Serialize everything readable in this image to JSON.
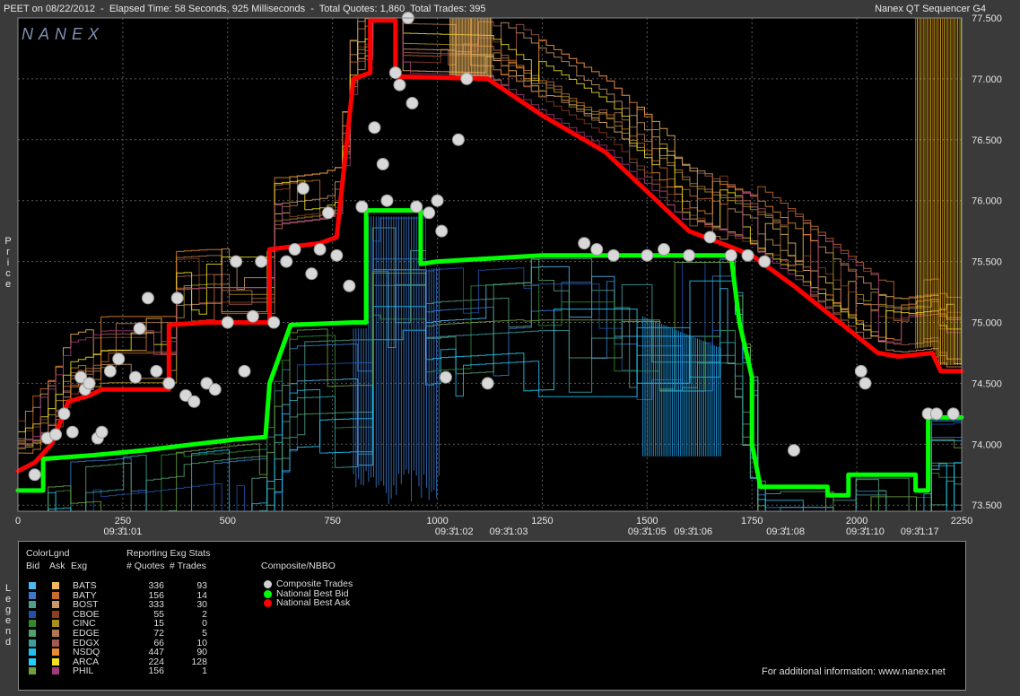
{
  "header": {
    "title": "PEET on 08/22/2012  -  Elapsed Time: 58 Seconds, 925 Milliseconds  -  Total Quotes: 1,860  Total Trades: 395",
    "app": "Nanex QT Sequencer G4"
  },
  "logo": "NANEX",
  "colors": {
    "background": "#3a3a3a",
    "plot": "#000000",
    "grid": "#5a5a5a",
    "bid": "#00ff00",
    "ask": "#ff0000",
    "trade": "#d8d8d8"
  },
  "chart_data": {
    "type": "scatter",
    "ylabel": "Price",
    "xlim": [
      0,
      2250
    ],
    "ylim": [
      73.45,
      77.5
    ],
    "x_ticks": [
      0,
      250,
      500,
      750,
      1000,
      1250,
      1500,
      1750,
      2000,
      2250
    ],
    "y_ticks": [
      "73.500",
      "74.000",
      "74.500",
      "75.000",
      "75.500",
      "76.000",
      "76.500",
      "77.000",
      "77.500"
    ],
    "time_ticks": [
      {
        "x": 250,
        "label": "09:31:01"
      },
      {
        "x": 1040,
        "label": "09:31:02"
      },
      {
        "x": 1170,
        "label": "09:31:03"
      },
      {
        "x": 1500,
        "label": "09:31:05"
      },
      {
        "x": 1610,
        "label": "09:31:06"
      },
      {
        "x": 1830,
        "label": "09:31:08"
      },
      {
        "x": 2020,
        "label": "09:31:10"
      },
      {
        "x": 2150,
        "label": "09:31:17"
      }
    ],
    "national_best_bid": [
      [
        0,
        73.62
      ],
      [
        60,
        73.62
      ],
      [
        60,
        73.88
      ],
      [
        180,
        73.91
      ],
      [
        300,
        73.95
      ],
      [
        420,
        74.0
      ],
      [
        520,
        74.04
      ],
      [
        590,
        74.06
      ],
      [
        600,
        74.5
      ],
      [
        650,
        74.98
      ],
      [
        800,
        75.0
      ],
      [
        830,
        75.0
      ],
      [
        830,
        75.92
      ],
      [
        960,
        75.92
      ],
      [
        960,
        75.48
      ],
      [
        1000,
        75.5
      ],
      [
        1150,
        75.53
      ],
      [
        1250,
        75.55
      ],
      [
        1500,
        75.55
      ],
      [
        1700,
        75.55
      ],
      [
        1720,
        75.0
      ],
      [
        1750,
        74.55
      ],
      [
        1750,
        74.0
      ],
      [
        1770,
        73.65
      ],
      [
        1930,
        73.65
      ],
      [
        1930,
        73.58
      ],
      [
        1980,
        73.58
      ],
      [
        1980,
        73.75
      ],
      [
        2140,
        73.75
      ],
      [
        2140,
        73.62
      ],
      [
        2170,
        73.62
      ],
      [
        2170,
        74.22
      ],
      [
        2250,
        74.22
      ]
    ],
    "national_best_ask": [
      [
        0,
        73.78
      ],
      [
        40,
        73.85
      ],
      [
        80,
        74.0
      ],
      [
        120,
        74.35
      ],
      [
        170,
        74.4
      ],
      [
        200,
        74.45
      ],
      [
        300,
        74.45
      ],
      [
        360,
        74.45
      ],
      [
        360,
        74.98
      ],
      [
        450,
        75.0
      ],
      [
        600,
        75.0
      ],
      [
        600,
        75.6
      ],
      [
        720,
        75.65
      ],
      [
        760,
        75.7
      ],
      [
        800,
        77.0
      ],
      [
        840,
        77.05
      ],
      [
        840,
        77.48
      ],
      [
        900,
        77.48
      ],
      [
        900,
        77.02
      ],
      [
        1120,
        77.0
      ],
      [
        1250,
        76.7
      ],
      [
        1400,
        76.4
      ],
      [
        1600,
        75.75
      ],
      [
        1700,
        75.62
      ],
      [
        1750,
        75.55
      ],
      [
        1850,
        75.3
      ],
      [
        2050,
        74.75
      ],
      [
        2100,
        74.72
      ],
      [
        2180,
        74.75
      ],
      [
        2200,
        74.6
      ],
      [
        2250,
        74.6
      ]
    ],
    "composite_trades": [
      [
        40,
        73.75
      ],
      [
        70,
        74.05
      ],
      [
        90,
        74.08
      ],
      [
        110,
        74.25
      ],
      [
        130,
        74.1
      ],
      [
        150,
        74.55
      ],
      [
        160,
        74.45
      ],
      [
        170,
        74.5
      ],
      [
        190,
        74.05
      ],
      [
        200,
        74.1
      ],
      [
        220,
        74.6
      ],
      [
        240,
        74.7
      ],
      [
        280,
        74.55
      ],
      [
        290,
        74.95
      ],
      [
        310,
        75.2
      ],
      [
        330,
        74.6
      ],
      [
        360,
        74.5
      ],
      [
        380,
        75.2
      ],
      [
        400,
        74.4
      ],
      [
        420,
        74.35
      ],
      [
        450,
        74.5
      ],
      [
        470,
        74.45
      ],
      [
        500,
        75.0
      ],
      [
        520,
        75.5
      ],
      [
        540,
        74.6
      ],
      [
        560,
        75.05
      ],
      [
        580,
        75.5
      ],
      [
        610,
        75.0
      ],
      [
        640,
        75.5
      ],
      [
        660,
        75.6
      ],
      [
        680,
        76.1
      ],
      [
        700,
        75.4
      ],
      [
        720,
        75.6
      ],
      [
        740,
        75.9
      ],
      [
        760,
        75.55
      ],
      [
        790,
        75.3
      ],
      [
        820,
        75.95
      ],
      [
        850,
        76.6
      ],
      [
        870,
        76.3
      ],
      [
        880,
        76.0
      ],
      [
        900,
        77.05
      ],
      [
        910,
        76.95
      ],
      [
        930,
        77.5
      ],
      [
        940,
        76.8
      ],
      [
        950,
        75.95
      ],
      [
        980,
        75.9
      ],
      [
        1000,
        76.0
      ],
      [
        1010,
        75.75
      ],
      [
        1020,
        74.55
      ],
      [
        1050,
        76.5
      ],
      [
        1070,
        77.0
      ],
      [
        1120,
        74.5
      ],
      [
        1350,
        75.65
      ],
      [
        1380,
        75.6
      ],
      [
        1420,
        75.55
      ],
      [
        1500,
        75.55
      ],
      [
        1540,
        75.6
      ],
      [
        1600,
        75.55
      ],
      [
        1650,
        75.7
      ],
      [
        1700,
        75.55
      ],
      [
        1740,
        75.55
      ],
      [
        1780,
        75.5
      ],
      [
        1850,
        73.95
      ],
      [
        2010,
        74.6
      ],
      [
        2020,
        74.5
      ],
      [
        2170,
        74.25
      ],
      [
        2190,
        74.25
      ],
      [
        2230,
        74.25
      ]
    ],
    "series": [
      {
        "name": "Composite Trades"
      },
      {
        "name": "National Best Bid"
      },
      {
        "name": "National Best Ask"
      }
    ]
  },
  "legend": {
    "side_label": "Legend",
    "headers": {
      "colorlgnd": "ColorLgnd",
      "bid": "Bid",
      "ask": "Ask",
      "exg": "Exg",
      "reporting": "Reporting Exg Stats",
      "quotes": "# Quotes",
      "trades": "# Trades",
      "composite": "Composite/NBBO"
    },
    "exchanges": [
      {
        "exg": "BATS",
        "quotes": "336",
        "trades": "93",
        "bid_color": "#4fb8f0",
        "ask_color": "#f0b860"
      },
      {
        "exg": "BATY",
        "quotes": "156",
        "trades": "14",
        "bid_color": "#3a78c8",
        "ask_color": "#c86a28"
      },
      {
        "exg": "BOST",
        "quotes": "333",
        "trades": "30",
        "bid_color": "#4fa088",
        "ask_color": "#c89868"
      },
      {
        "exg": "CBOE",
        "quotes": "55",
        "trades": "2",
        "bid_color": "#2050a8",
        "ask_color": "#8a4020"
      },
      {
        "exg": "CINC",
        "quotes": "15",
        "trades": "0",
        "bid_color": "#308830",
        "ask_color": "#a89020"
      },
      {
        "exg": "EDGE",
        "quotes": "72",
        "trades": "5",
        "bid_color": "#50a070",
        "ask_color": "#b07850"
      },
      {
        "exg": "EDGX",
        "quotes": "66",
        "trades": "10",
        "bid_color": "#3aa0a0",
        "ask_color": "#a05a50"
      },
      {
        "exg": "NSDQ",
        "quotes": "447",
        "trades": "90",
        "bid_color": "#20c0f0",
        "ask_color": "#e88830"
      },
      {
        "exg": "ARCA",
        "quotes": "224",
        "trades": "128",
        "bid_color": "#20d0ff",
        "ask_color": "#f0e020"
      },
      {
        "exg": "PHIL",
        "quotes": "156",
        "trades": "1",
        "bid_color": "#70a040",
        "ask_color": "#a03a7a"
      }
    ],
    "composite_items": [
      {
        "label": "Composite Trades",
        "color": "#d0d0d0"
      },
      {
        "label": "National Best Bid",
        "color": "#00ff00"
      },
      {
        "label": "National Best Ask",
        "color": "#ff0000"
      }
    ],
    "footer": "For additional information: www.nanex.net"
  }
}
